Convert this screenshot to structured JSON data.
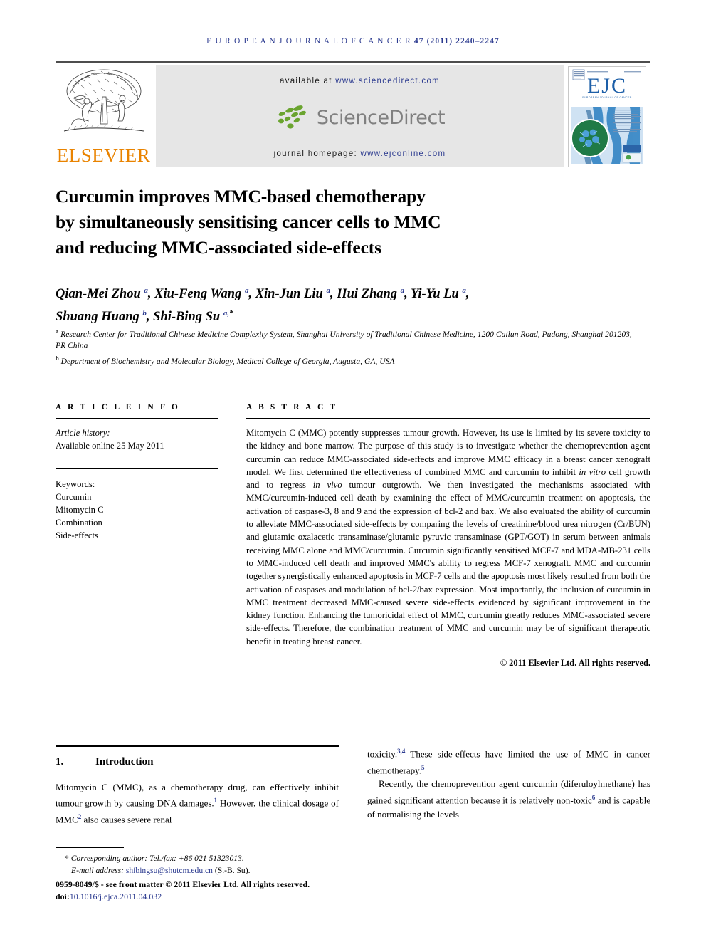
{
  "running_head": {
    "journal": "E U R O P E A N   J O U R N A L   O F   C A N C E R",
    "volume_line": "47 (2011) 2240–2247"
  },
  "header": {
    "publisher": "ELSEVIER",
    "available_prefix": "available at",
    "available_url": "www.sciencedirect.com",
    "sciencedirect_word": "ScienceDirect",
    "homepage_prefix": "journal homepage:",
    "homepage_url": "www.ejconline.com",
    "cover_title": "EJC",
    "cover_subtitle": "EUROPEAN JOURNAL OF CANCER",
    "colors": {
      "elsevier_orange": "#e98300",
      "banner_gray": "#e6e6e6",
      "sd_green": "#6aa42f",
      "sd_gray": "#808080",
      "link_blue": "#2b3a8f"
    }
  },
  "article": {
    "title_lines": [
      "Curcumin improves MMC-based chemotherapy",
      "by simultaneously sensitising cancer cells to MMC",
      "and reducing MMC-associated side-effects"
    ],
    "authors_html": "Qian-Mei Zhou <sup>a</sup>, Xiu-Feng Wang <sup>a</sup>, Xin-Jun Liu <sup>a</sup>, Hui Zhang <sup>a</sup>, Yi-Yu Lu <sup>a</sup>,<br>Shuang Huang <sup>b</sup>, Shi-Bing Su <sup>a,</sup><sup class=\"star\">*</sup>",
    "affiliation_a": "Research Center for Traditional Chinese Medicine Complexity System, Shanghai University of Traditional Chinese Medicine, 1200 Cailun Road, Pudong, Shanghai 201203, PR China",
    "affiliation_b": "Department of Biochemistry and Molecular Biology, Medical College of Georgia, Augusta, GA, USA"
  },
  "article_info": {
    "heading": "A R T I C L E   I N F O",
    "history_label": "Article history:",
    "history_value": "Available online 25 May 2011",
    "keywords_label": "Keywords:",
    "keywords": [
      "Curcumin",
      "Mitomycin C",
      "Combination",
      "Side-effects"
    ]
  },
  "abstract": {
    "heading": "A B S T R A C T",
    "text_html": "Mitomycin C (MMC) potently suppresses tumour growth. However, its use is limited by its severe toxicity to the kidney and bone marrow. The purpose of this study is to investigate whether the chemoprevention agent curcumin can reduce MMC-associated side-effects and improve MMC efficacy in a breast cancer xenograft model. We first determined the effectiveness of combined MMC and curcumin to inhibit <i>in vitro</i> cell growth and to regress <i>in vivo</i> tumour outgrowth. We then investigated the mechanisms associated with MMC/curcumin-induced cell death by examining the effect of MMC/curcumin treatment on apoptosis, the activation of caspase-3, 8 and 9 and the expression of bcl-2 and bax. We also evaluated the ability of curcumin to alleviate MMC-associated side-effects by comparing the levels of creatinine/blood urea nitrogen (Cr/BUN) and glutamic oxalacetic transaminase/glutamic pyruvic transaminase (GPT/GOT) in serum between animals receiving MMC alone and MMC/curcumin. Curcumin significantly sensitised MCF-7 and MDA-MB-231 cells to MMC-induced cell death and improved MMC's ability to regress MCF-7 xenograft. MMC and curcumin together synergistically enhanced apoptosis in MCF-7 cells and the apoptosis most likely resulted from both the activation of caspases and modulation of bcl-2/bax expression. Most importantly, the inclusion of curcumin in MMC treatment decreased MMC-caused severe side-effects evidenced by significant improvement in the kidney function. Enhancing the tumoricidal effect of MMC, curcumin greatly reduces MMC-associated severe side-effects. Therefore, the combination treatment of MMC and curcumin may be of significant therapeutic benefit in treating breast cancer.",
    "copyright": "© 2011 Elsevier Ltd. All rights reserved."
  },
  "body": {
    "section_number": "1.",
    "section_title": "Introduction",
    "left_paragraph_html": "Mitomycin C (MMC), as a chemotherapy drug, can effectively inhibit tumour growth by causing DNA damages.<sup>1</sup> However, the clinical dosage of MMC<sup>2</sup> also causes severe renal",
    "right_paragraph_1_html": "toxicity.<sup>3,4</sup> These side-effects have limited the use of MMC in cancer chemotherapy.<sup>5</sup>",
    "right_paragraph_2_html": "Recently, the chemoprevention agent curcumin (diferuloylmethane) has gained significant attention because it is relatively non-toxic<sup>6</sup> and is capable of normalising the levels"
  },
  "footnote": {
    "corresponding_marker": "*",
    "corresponding_text": "Corresponding author: Tel./fax: +86 021 51323013.",
    "email_label": "E-mail address:",
    "email": "shibingsu@shutcm.edu.cn",
    "email_owner": "(S.-B. Su).",
    "issn_line": "0959-8049/$ - see front matter © 2011 Elsevier Ltd. All rights reserved.",
    "doi_label": "doi:",
    "doi_value": "10.1016/j.ejca.2011.04.032"
  }
}
